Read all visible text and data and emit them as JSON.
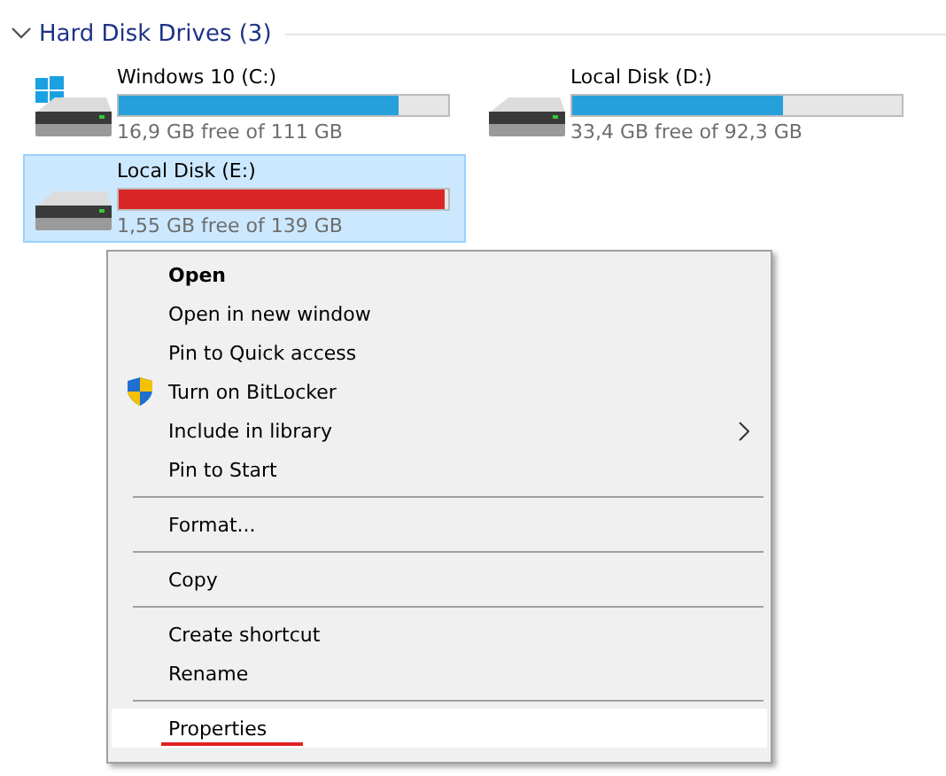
{
  "group": {
    "title": "Hard Disk Drives (3)",
    "expanded": true
  },
  "drives": [
    {
      "name": "Windows 10 (C:)",
      "kind": "system",
      "level": 0.85,
      "color": "#26a0da",
      "free": "16,9 GB free of 111 GB",
      "selected": false
    },
    {
      "name": "Local Disk (D:)",
      "kind": "disk",
      "level": 0.64,
      "color": "#26a0da",
      "free": "33,4 GB free of 92,3 GB",
      "selected": false
    },
    {
      "name": "Local Disk (E:)",
      "kind": "disk",
      "level": 0.99,
      "color": "#da2626",
      "free": "1,55 GB free of 139 GB",
      "selected": true
    }
  ],
  "menu": [
    {
      "kind": "item",
      "label": "Open",
      "bold": true,
      "submenu": false,
      "selected": false,
      "underlined": false
    },
    {
      "kind": "item",
      "label": "Open in new window",
      "bold": false,
      "submenu": false,
      "selected": false,
      "underlined": false
    },
    {
      "kind": "item",
      "label": "Pin to Quick access",
      "bold": false,
      "submenu": false,
      "selected": false,
      "underlined": false
    },
    {
      "kind": "secured",
      "label": "Turn on BitLocker",
      "bold": false,
      "submenu": false,
      "selected": false,
      "underlined": false
    },
    {
      "kind": "item",
      "label": "Include in library",
      "bold": false,
      "submenu": true,
      "selected": false,
      "underlined": false
    },
    {
      "kind": "item",
      "label": "Pin to Start",
      "bold": false,
      "submenu": false,
      "selected": false,
      "underlined": false
    },
    {
      "kind": "separator"
    },
    {
      "kind": "item",
      "label": "Format...",
      "bold": false,
      "submenu": false,
      "selected": false,
      "underlined": false
    },
    {
      "kind": "separator"
    },
    {
      "kind": "item",
      "label": "Copy",
      "bold": false,
      "submenu": false,
      "selected": false,
      "underlined": false
    },
    {
      "kind": "separator"
    },
    {
      "kind": "item",
      "label": "Create shortcut",
      "bold": false,
      "submenu": false,
      "selected": false,
      "underlined": false
    },
    {
      "kind": "item",
      "label": "Rename",
      "bold": false,
      "submenu": false,
      "selected": false,
      "underlined": false
    },
    {
      "kind": "separator"
    },
    {
      "kind": "item",
      "label": "Properties",
      "bold": false,
      "submenu": false,
      "selected": true,
      "underlined": true
    }
  ]
}
